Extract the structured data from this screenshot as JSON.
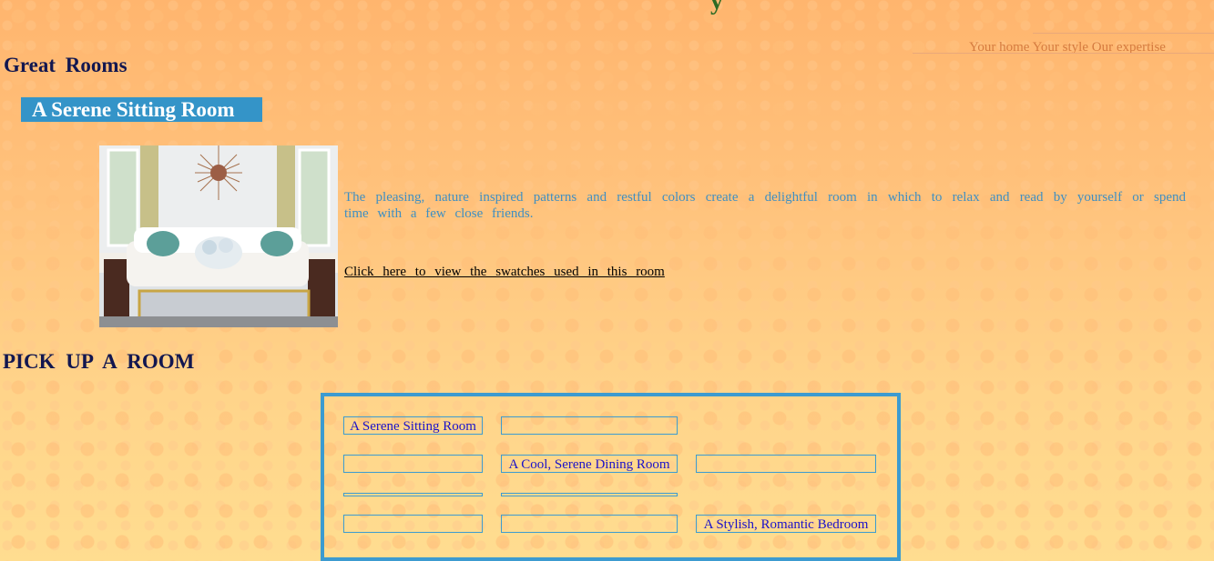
{
  "header": {
    "title_fragment": "y",
    "tagline": "Your home Your style Our expertise"
  },
  "section": {
    "title": "Great  Rooms"
  },
  "room": {
    "title": "A Serene Sitting Room",
    "description": "The pleasing, nature inspired patterns and restful colors create a delightful room in which to relax and read by yourself or spend time with a few close friends.",
    "swatch_link": "Click here to view the swatches used in this room"
  },
  "pick": {
    "title": "PICK UP A ROOM",
    "rooms": {
      "sitting": "A Serene Sitting Room",
      "dining": "A Cool, Serene Dining Room",
      "bedroom": "A Stylish, Romantic Bedroom"
    }
  },
  "colors": {
    "accent_blue": "#3494c8",
    "heading_navy": "#121750",
    "link_blue": "#1b12c9",
    "tagline_orange": "#d57b3f"
  }
}
